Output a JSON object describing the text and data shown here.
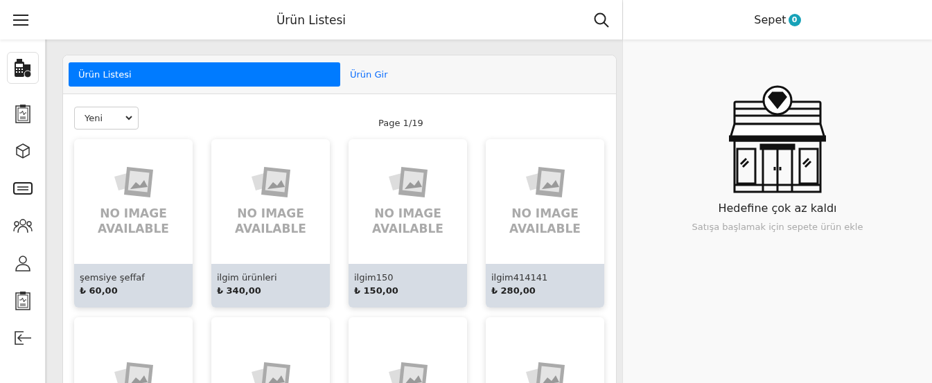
{
  "header": {
    "title": "Ürün Listesi"
  },
  "sidebar": {
    "items": [
      {
        "kind": "pos",
        "selected": true
      },
      {
        "kind": "report",
        "selected": false
      },
      {
        "kind": "box",
        "selected": false
      },
      {
        "kind": "card",
        "selected": false
      },
      {
        "kind": "group",
        "selected": false
      },
      {
        "kind": "user",
        "selected": false
      },
      {
        "kind": "report",
        "selected": false
      },
      {
        "kind": "logout",
        "selected": false
      }
    ]
  },
  "tabs": [
    {
      "label": "Ürün Listesi",
      "selected": true
    },
    {
      "label": "Ürün Gir",
      "selected": false
    }
  ],
  "sort_select": {
    "value": "Yeni"
  },
  "page_indicator": "Page 1/19",
  "products": [
    {
      "kind": "full",
      "image_label": "NO IMAGE AVAILABLE",
      "name": "şemsiye şeffaf",
      "price": "₺ 60,00"
    },
    {
      "kind": "full",
      "image_label": "NO IMAGE AVAILABLE",
      "name": "ilgim ürünleri",
      "price": "₺ 340,00"
    },
    {
      "kind": "full",
      "image_label": "NO IMAGE AVAILABLE",
      "name": "ilgim150",
      "price": "₺ 150,00"
    },
    {
      "kind": "full",
      "image_label": "NO IMAGE AVAILABLE",
      "name": "ilgim414141",
      "price": "₺ 280,00"
    },
    {
      "kind": "cut_off"
    },
    {
      "kind": "cut_off"
    },
    {
      "kind": "cut_off"
    },
    {
      "kind": "cut_off"
    }
  ],
  "cart": {
    "title": "Sepet",
    "count": "0",
    "empty_title": "Hedefine çok az kaldı",
    "empty_text": "Satışa başlamak için sepete ürün ekle"
  }
}
